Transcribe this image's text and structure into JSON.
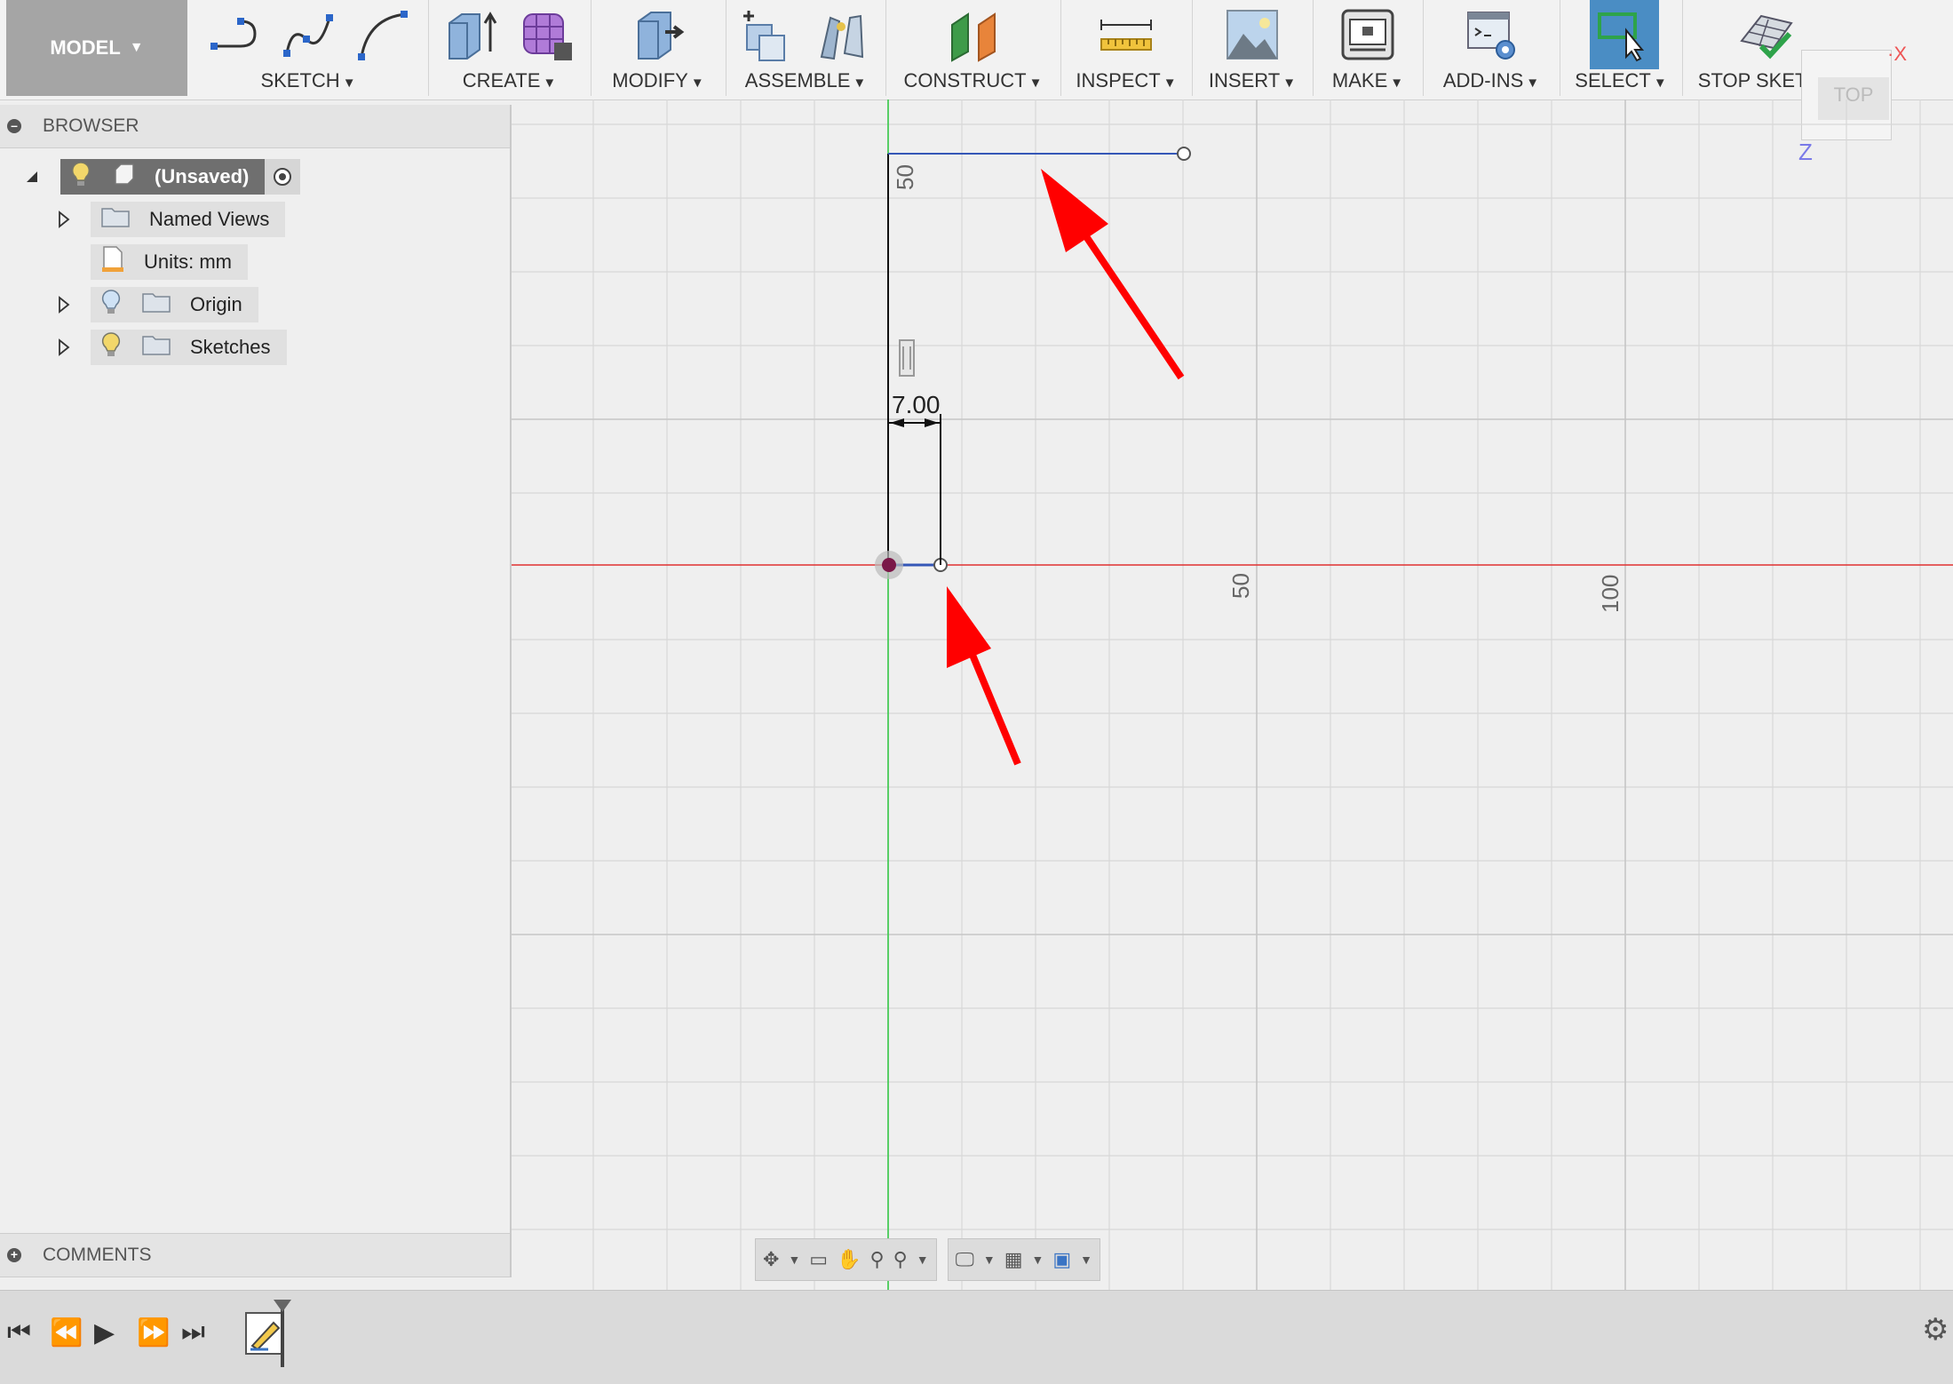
{
  "toolbar": {
    "mode": "MODEL",
    "groups": {
      "sketch": "SKETCH",
      "create": "CREATE",
      "modify": "MODIFY",
      "assemble": "ASSEMBLE",
      "construct": "CONSTRUCT",
      "inspect": "INSPECT",
      "insert": "INSERT",
      "make": "MAKE",
      "addins": "ADD-INS",
      "select": "SELECT",
      "stop_sketch": "STOP SKETCH"
    },
    "caret": "▼"
  },
  "viewcube": {
    "face": "TOP",
    "x_axis": "X",
    "z_axis": "Z"
  },
  "browser": {
    "title": "BROWSER",
    "root": "(Unsaved)",
    "items": [
      {
        "label": "Named Views"
      },
      {
        "label": "Units: mm"
      },
      {
        "label": "Origin"
      },
      {
        "label": "Sketches"
      }
    ]
  },
  "comments": {
    "title": "COMMENTS"
  },
  "canvas": {
    "ruler_labels": {
      "v50": "50",
      "h50": "50",
      "h100": "100"
    },
    "dimension": "7.00",
    "colors": {
      "x_axis": "#e03030",
      "y_axis": "#2ecc40",
      "sketch_line": "#3557b7",
      "arrow": "#ff0000"
    }
  }
}
